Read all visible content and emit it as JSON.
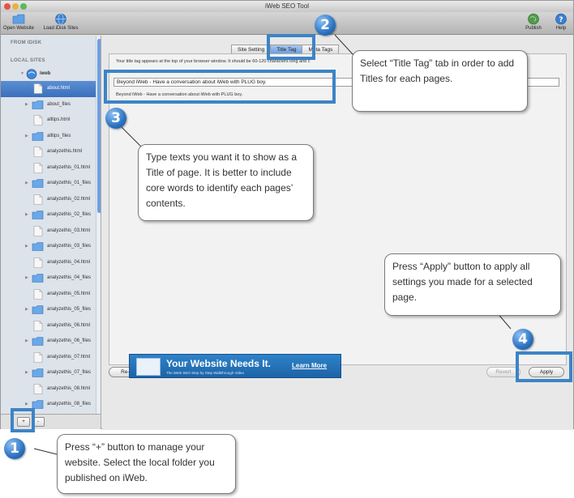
{
  "window": {
    "title": "iWeb SEO Tool",
    "toolbar": {
      "open_website": "Open Website",
      "load_idisk": "Load iDisk Sites",
      "publish": "Publish",
      "help": "Help"
    }
  },
  "sidebar": {
    "from_idisk": "FROM IDISK",
    "local_sites": "LOCAL SITES",
    "site_name": "iweb",
    "items": [
      {
        "label": "about.html",
        "type": "file",
        "selected": true
      },
      {
        "label": "about_files",
        "type": "folder"
      },
      {
        "label": "alltips.html",
        "type": "file"
      },
      {
        "label": "alltips_files",
        "type": "folder"
      },
      {
        "label": "analyzethis.html",
        "type": "file"
      },
      {
        "label": "analyzethis_01.html",
        "type": "file"
      },
      {
        "label": "analyzethis_01_files",
        "type": "folder"
      },
      {
        "label": "analyzethis_02.html",
        "type": "file"
      },
      {
        "label": "analyzethis_02_files",
        "type": "folder"
      },
      {
        "label": "analyzethis_03.html",
        "type": "file"
      },
      {
        "label": "analyzethis_03_files",
        "type": "folder"
      },
      {
        "label": "analyzethis_04.html",
        "type": "file"
      },
      {
        "label": "analyzethis_04_files",
        "type": "folder"
      },
      {
        "label": "analyzethis_05.html",
        "type": "file"
      },
      {
        "label": "analyzethis_05_files",
        "type": "folder"
      },
      {
        "label": "analyzethis_06.html",
        "type": "file"
      },
      {
        "label": "analyzethis_06_files",
        "type": "folder"
      },
      {
        "label": "analyzethis_07.html",
        "type": "file"
      },
      {
        "label": "analyzethis_07_files",
        "type": "folder"
      },
      {
        "label": "analyzethis_08.html",
        "type": "file"
      },
      {
        "label": "analyzethis_08_files",
        "type": "folder"
      }
    ],
    "add_button": "+",
    "remove_button": "-"
  },
  "main": {
    "tabs": [
      {
        "label": "Site Setting",
        "active": false
      },
      {
        "label": "Title Tag",
        "active": true
      },
      {
        "label": "Meta Tags",
        "active": false
      }
    ],
    "description": "Your title tag appears at the top of your browser window. It should be 60-120 characters long and c",
    "title_value": "Beyond iWeb - Have a conversation about iWeb with PLUG boy.",
    "preview": "Beyond iWeb - Have a conversation about iWeb with PLUG boy.",
    "reapply_button": "Re-apply Saved Tags",
    "revert_button": "Revert",
    "apply_button": "Apply",
    "banner": {
      "headline": "Your Website Needs It.",
      "subline": "The iWeb SEO Step by Step Walkthrough Video",
      "link": "Learn More"
    }
  },
  "annotations": {
    "step1": {
      "number": "1",
      "text": "Press “+” button to manage your website. Select the local folder you published on iWeb."
    },
    "step2": {
      "number": "2",
      "text": "Select “Title Tag” tab in order to add Titles for each pages."
    },
    "step3": {
      "number": "3",
      "text": "Type texts you want it to show as a Title of page. It is better to include core words to identify each pages’ contents."
    },
    "step4": {
      "number": "4",
      "text": "Press “Apply” button to apply all settings you made for a selected page."
    }
  },
  "colors": {
    "accent": "#3c84c6",
    "selection": "#3a6fbc"
  }
}
